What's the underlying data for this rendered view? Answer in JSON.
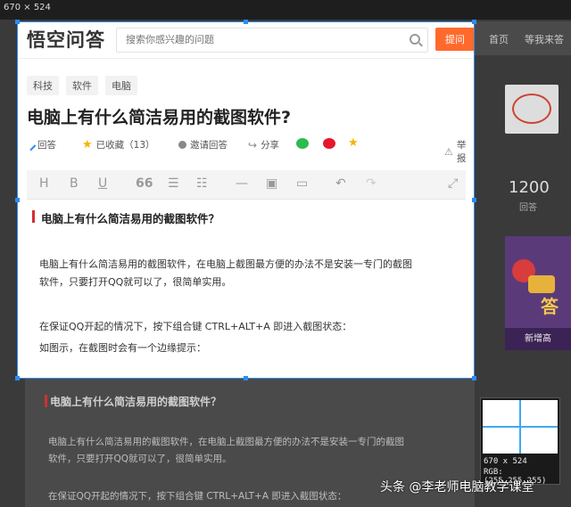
{
  "dim_label": "670 × 524",
  "bg": {
    "nav": [
      "首页",
      "等我来答"
    ],
    "stat_value": "1200",
    "stat_label": "回答",
    "banner_text": "答",
    "banner_caption": "新增高",
    "article": {
      "heading": "电脑上有什么简洁易用的截图软件？",
      "paragraphs": [
        "电脑上有什么简洁易用的截图软件，在电脑上截图最方便的办法不是安装一专门的截图",
        "软件，只要打开QQ就可以了，很简单实用。",
        "在保证QQ开起的情况下，按下组合键 CTRL+ALT+A 即进入截图状态："
      ]
    }
  },
  "header": {
    "logo": "悟空问答",
    "search_placeholder": "搜索你感兴趣的问题",
    "ask_button": "提问"
  },
  "tags": [
    "科技",
    "软件",
    "电脑"
  ],
  "question": {
    "title": "电脑上有什么简洁易用的截图软件?"
  },
  "actions": {
    "answer": "回答",
    "favorited": "已收藏（13）",
    "invite": "邀请回答",
    "share": "分享",
    "report": "举报"
  },
  "toolbar": {
    "heading": "H",
    "bold": "B",
    "underline": "U",
    "quote": "66"
  },
  "editor": {
    "heading": "电脑上有什么简洁易用的截图软件？",
    "p1_line1": "电脑上有什么简洁易用的截图软件，在电脑上截图最方便的办法不是安装一专门的截图",
    "p1_line2": "软件，只要打开QQ就可以了，很简单实用。",
    "p2": "在保证QQ开起的情况下，按下组合键 CTRL+ALT+A 即进入截图状态：",
    "p3": "如图示，在截图时会有一个边缘提示："
  },
  "picker": {
    "size": "670 x 524",
    "rgb": "RGB:(255,255,255)"
  },
  "watermark": "头条 @李老师电脑教学课堂",
  "colors": {
    "accent": "#2d8cf0",
    "ask_button": "#ff6a2c",
    "star": "#f5b400"
  }
}
